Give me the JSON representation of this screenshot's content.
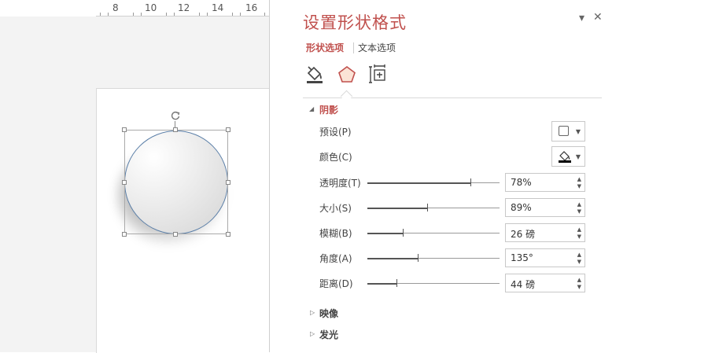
{
  "ruler": {
    "labels": [
      "8",
      "10",
      "12",
      "14",
      "16"
    ]
  },
  "panel": {
    "title": "设置形状格式",
    "controls": {
      "menu_glyph": "▾",
      "close_glyph": "✕"
    },
    "tabs": [
      {
        "label": "形状选项",
        "active": true
      },
      {
        "label": "文本选项",
        "active": false
      }
    ],
    "icons": [
      {
        "name": "fill-line-icon"
      },
      {
        "name": "effects-pentagon-icon"
      },
      {
        "name": "size-properties-icon"
      }
    ],
    "accent_color": "#c0504d",
    "shadow_section": {
      "title": "阴影",
      "preset_label": "预设(P)",
      "color_label": "颜色(C)",
      "sliders": [
        {
          "label": "透明度(T)",
          "value": "78%",
          "level": 0.78
        },
        {
          "label": "大小(S)",
          "value": "89%",
          "level": 0.45
        },
        {
          "label": "模糊(B)",
          "value": "26 磅",
          "level": 0.27
        },
        {
          "label": "角度(A)",
          "value": "135°",
          "level": 0.38
        },
        {
          "label": "距离(D)",
          "value": "44 磅",
          "level": 0.22
        }
      ]
    },
    "collapsed_sections": [
      "映像",
      "发光"
    ]
  }
}
